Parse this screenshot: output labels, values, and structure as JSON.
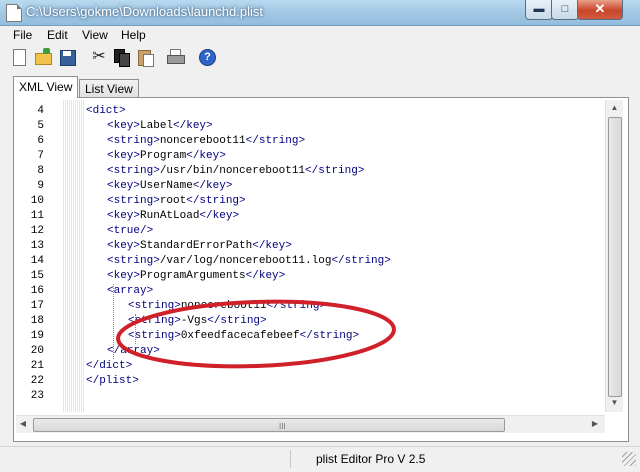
{
  "window": {
    "title": "C:\\Users\\gokme\\Downloads\\launchd.plist",
    "min_glyph": "▬",
    "max_glyph": "□",
    "close_glyph": "✕"
  },
  "menu": [
    "File",
    "Edit",
    "View",
    "Help"
  ],
  "toolbar": {
    "icons": [
      "new-icon",
      "open-icon",
      "save-icon",
      "cut-icon",
      "copy-icon",
      "paste-icon",
      "print-icon",
      "help-icon"
    ],
    "cut_glyph": "✂",
    "help_glyph": "?"
  },
  "tabs": [
    {
      "label": "XML View",
      "active": true
    },
    {
      "label": "List View",
      "active": false
    }
  ],
  "editor": {
    "lines": [
      {
        "num": "4",
        "indent": 0,
        "parts": [
          [
            "<dict>",
            "br"
          ]
        ]
      },
      {
        "num": "5",
        "indent": 1,
        "parts": [
          [
            "<key>",
            "br"
          ],
          [
            "Label",
            ""
          ],
          [
            "</key>",
            "br"
          ]
        ]
      },
      {
        "num": "6",
        "indent": 1,
        "parts": [
          [
            "<string>",
            "br"
          ],
          [
            "noncereboot11",
            ""
          ],
          [
            "</string>",
            "br"
          ]
        ]
      },
      {
        "num": "7",
        "indent": 1,
        "parts": [
          [
            "<key>",
            "br"
          ],
          [
            "Program",
            ""
          ],
          [
            "</key>",
            "br"
          ]
        ]
      },
      {
        "num": "8",
        "indent": 1,
        "parts": [
          [
            "<string>",
            "br"
          ],
          [
            "/usr/bin/noncereboot11",
            ""
          ],
          [
            "</string>",
            "br"
          ]
        ]
      },
      {
        "num": "9",
        "indent": 1,
        "parts": [
          [
            "<key>",
            "br"
          ],
          [
            "UserName",
            ""
          ],
          [
            "</key>",
            "br"
          ]
        ]
      },
      {
        "num": "10",
        "indent": 1,
        "parts": [
          [
            "<string>",
            "br"
          ],
          [
            "root",
            ""
          ],
          [
            "</string>",
            "br"
          ]
        ]
      },
      {
        "num": "11",
        "indent": 1,
        "parts": [
          [
            "<key>",
            "br"
          ],
          [
            "RunAtLoad",
            ""
          ],
          [
            "</key>",
            "br"
          ]
        ]
      },
      {
        "num": "12",
        "indent": 1,
        "parts": [
          [
            "<true/>",
            "br"
          ]
        ]
      },
      {
        "num": "13",
        "indent": 1,
        "parts": [
          [
            "<key>",
            "br"
          ],
          [
            "StandardErrorPath",
            ""
          ],
          [
            "</key>",
            "br"
          ]
        ]
      },
      {
        "num": "14",
        "indent": 1,
        "parts": [
          [
            "<string>",
            "br"
          ],
          [
            "/var/log/noncereboot11.log",
            ""
          ],
          [
            "</string>",
            "br"
          ]
        ]
      },
      {
        "num": "15",
        "indent": 1,
        "parts": [
          [
            "<key>",
            "br"
          ],
          [
            "ProgramArguments",
            ""
          ],
          [
            "</key>",
            "br"
          ]
        ]
      },
      {
        "num": "16",
        "indent": 1,
        "parts": [
          [
            "<array>",
            "br"
          ]
        ]
      },
      {
        "num": "17",
        "indent": 2,
        "parts": [
          [
            "<string>",
            "br"
          ],
          [
            "noncereboot11",
            ""
          ],
          [
            "</string>",
            "br"
          ]
        ]
      },
      {
        "num": "18",
        "indent": 2,
        "parts": [
          [
            "<string>",
            "br"
          ],
          [
            "-Vgs",
            ""
          ],
          [
            "</string>",
            "br"
          ]
        ]
      },
      {
        "num": "19",
        "indent": 2,
        "parts": [
          [
            "<string>",
            "br"
          ],
          [
            "0xfeedfacecafebeef",
            ""
          ],
          [
            "</string>",
            "br"
          ]
        ]
      },
      {
        "num": "20",
        "indent": 1,
        "parts": [
          [
            "</array>",
            "br"
          ]
        ]
      },
      {
        "num": "21",
        "indent": 0,
        "parts": [
          [
            "</dict>",
            "br"
          ]
        ]
      },
      {
        "num": "22",
        "indent": 0,
        "parts": [
          [
            "</plist>",
            "br"
          ]
        ]
      },
      {
        "num": "23",
        "indent": 0,
        "parts": []
      }
    ]
  },
  "scroll": {
    "up_glyph": "▲",
    "down_glyph": "▼",
    "left_glyph": "◀",
    "right_glyph": "▶",
    "grip": "III"
  },
  "status": {
    "text": "plist Editor Pro V 2.5"
  },
  "annotation": {
    "color": "#d0202a"
  }
}
